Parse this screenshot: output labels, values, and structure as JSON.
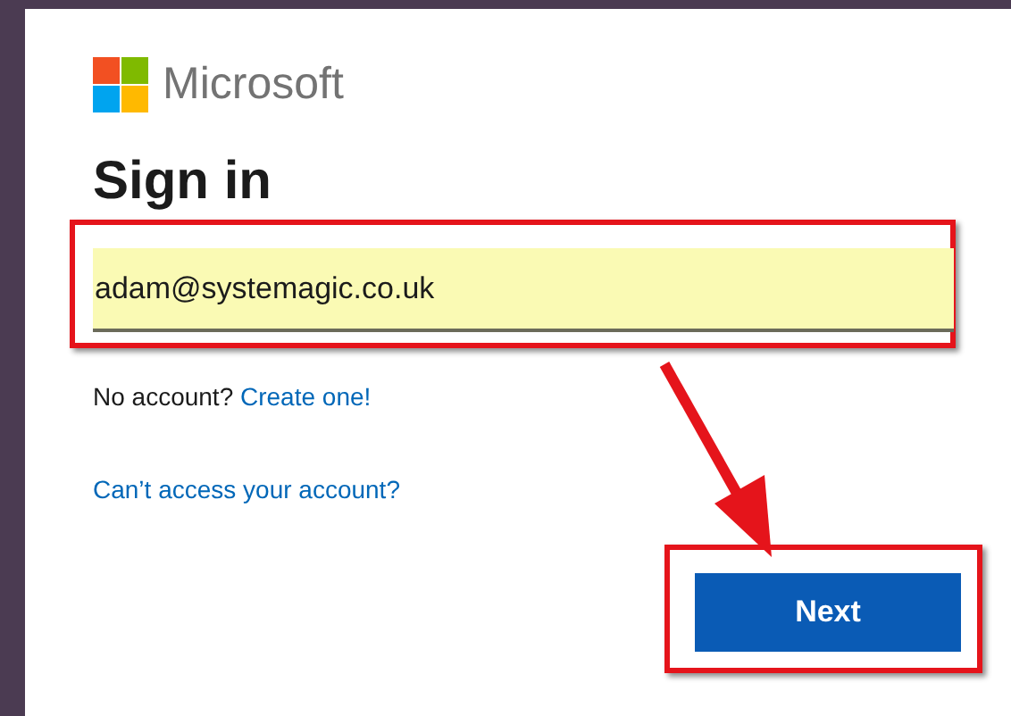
{
  "logo": {
    "text": "Microsoft"
  },
  "heading": "Sign in",
  "email_field": {
    "value": "adam@systemagic.co.uk",
    "highlighted": true
  },
  "no_account": {
    "prompt": "No account?",
    "link": "Create one!"
  },
  "cant_access_link": "Can’t access your account?",
  "next_button": {
    "label": "Next",
    "highlighted": true
  }
}
